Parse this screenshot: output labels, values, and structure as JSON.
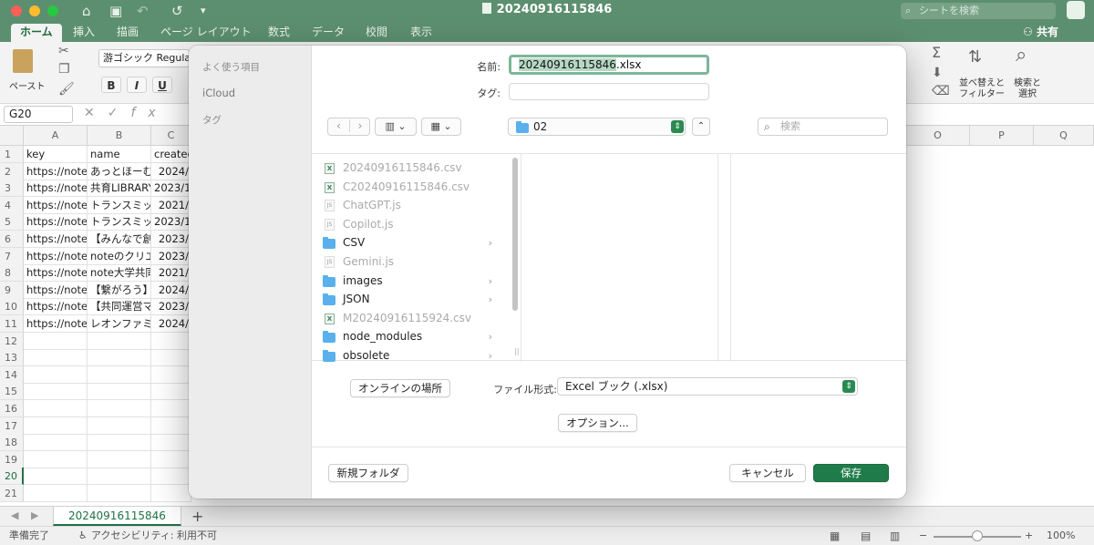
{
  "window": {
    "title": "20240916115846",
    "search_placeholder": "シートを検索"
  },
  "ribbon_tabs": [
    "ホーム",
    "挿入",
    "描画",
    "ページ レイアウト",
    "数式",
    "データ",
    "校閲",
    "表示"
  ],
  "share_label": "共有",
  "ribbon": {
    "paste_label": "ペースト",
    "font_name": "游ゴシック Regular",
    "bold": "B",
    "italic": "I",
    "underline": "U",
    "sort_filter_label": "並べ替えと\nフィルター",
    "find_select_label": "検索と\n選択"
  },
  "formula_bar": {
    "name_box": "G20",
    "fx": "fx"
  },
  "sheet": {
    "columns": [
      "A",
      "B",
      "C",
      "O",
      "P",
      "Q"
    ],
    "rows": [
      [
        "key",
        "name",
        "created"
      ],
      [
        "https://note.",
        "あっとほーむ",
        "2024/"
      ],
      [
        "https://note.",
        "共育LIBRARY",
        "2023/1"
      ],
      [
        "https://note.",
        "トランスミッ",
        "2021/"
      ],
      [
        "https://note.",
        "トランスミッ",
        "2023/1"
      ],
      [
        "https://note.",
        "【みんなで創",
        "2023/"
      ],
      [
        "https://note.",
        "noteのクリエ",
        "2023/"
      ],
      [
        "https://note.",
        "note大学共同",
        "2021/"
      ],
      [
        "https://note.",
        "【繋がろう】",
        "2024/"
      ],
      [
        "https://note.",
        "【共同運営マ",
        "2023/"
      ],
      [
        "https://note.",
        "レオンファミ",
        "2024/"
      ]
    ],
    "row_numbers": [
      "1",
      "2",
      "3",
      "4",
      "5",
      "6",
      "7",
      "8",
      "9",
      "10",
      "11",
      "12",
      "13",
      "14",
      "15",
      "16",
      "17",
      "18",
      "19",
      "20",
      "21"
    ],
    "selected_row": "20",
    "tab_name": "20240916115846"
  },
  "status_bar": {
    "ready": "準備完了",
    "accessibility": "アクセシビリティ: 利用不可",
    "zoom": "100%",
    "zoom_level": 0.5
  },
  "dialog": {
    "sidebar": {
      "favorites": "よく使う項目",
      "icloud": "iCloud",
      "tags": "タグ"
    },
    "name_label": "名前:",
    "filename_base": "20240916115846",
    "filename_ext": ".xlsx",
    "tag_label": "タグ:",
    "location": "02",
    "search_placeholder": "検索",
    "files": [
      {
        "name": "20240916115846.csv",
        "kind": "csv",
        "enabled": false
      },
      {
        "name": "C20240916115846.csv",
        "kind": "csv",
        "enabled": false
      },
      {
        "name": "ChatGPT.js",
        "kind": "js",
        "enabled": false
      },
      {
        "name": "Copilot.js",
        "kind": "js",
        "enabled": false
      },
      {
        "name": "CSV",
        "kind": "folder",
        "enabled": true
      },
      {
        "name": "Gemini.js",
        "kind": "js",
        "enabled": false
      },
      {
        "name": "images",
        "kind": "folder",
        "enabled": true
      },
      {
        "name": "JSON",
        "kind": "folder",
        "enabled": true
      },
      {
        "name": "M20240916115924.csv",
        "kind": "csv",
        "enabled": false
      },
      {
        "name": "node_modules",
        "kind": "folder",
        "enabled": true
      },
      {
        "name": "obsolete",
        "kind": "folder",
        "enabled": true
      }
    ],
    "online_locations_button": "オンラインの場所",
    "format_label": "ファイル形式:",
    "format_value": "Excel ブック (.xlsx)",
    "options_button": "オプション...",
    "new_folder_button": "新規フォルダ",
    "cancel_button": "キャンセル",
    "save_button": "保存"
  },
  "colors": {
    "excel_green": "#5c8f6f",
    "primary_button": "#1f7c4a",
    "folder_blue": "#5ab0ec"
  }
}
